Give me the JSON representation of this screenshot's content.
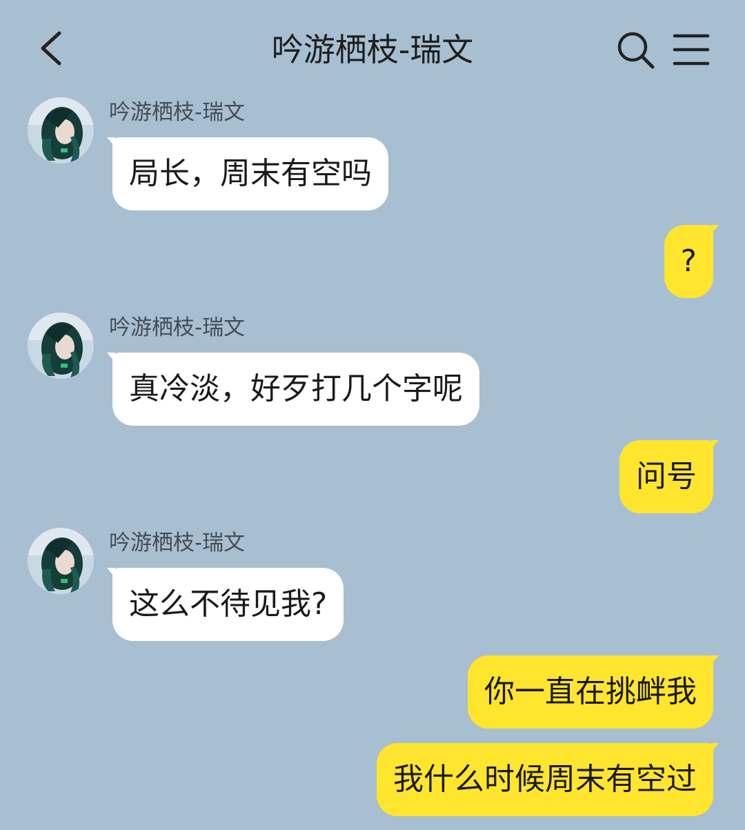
{
  "header": {
    "title": "吟游栖枝-瑞文",
    "back_icon": "chevron-left-icon",
    "search_icon": "search-icon",
    "menu_icon": "hamburger-menu-icon"
  },
  "colors": {
    "background": "#a8bfd2",
    "incoming_bubble": "#ffffff",
    "outgoing_bubble": "#ffe52e"
  },
  "messages": [
    {
      "side": "incoming",
      "sender": "吟游栖枝-瑞文",
      "text": "局长，周末有空吗"
    },
    {
      "side": "outgoing",
      "text": "?"
    },
    {
      "side": "incoming",
      "sender": "吟游栖枝-瑞文",
      "text": "真冷淡，好歹打几个字呢"
    },
    {
      "side": "outgoing",
      "text": "问号"
    },
    {
      "side": "incoming",
      "sender": "吟游栖枝-瑞文",
      "text": "这么不待见我?"
    },
    {
      "side": "outgoing",
      "text": "你一直在挑衅我"
    },
    {
      "side": "outgoing",
      "text": "我什么时候周末有空过"
    }
  ]
}
